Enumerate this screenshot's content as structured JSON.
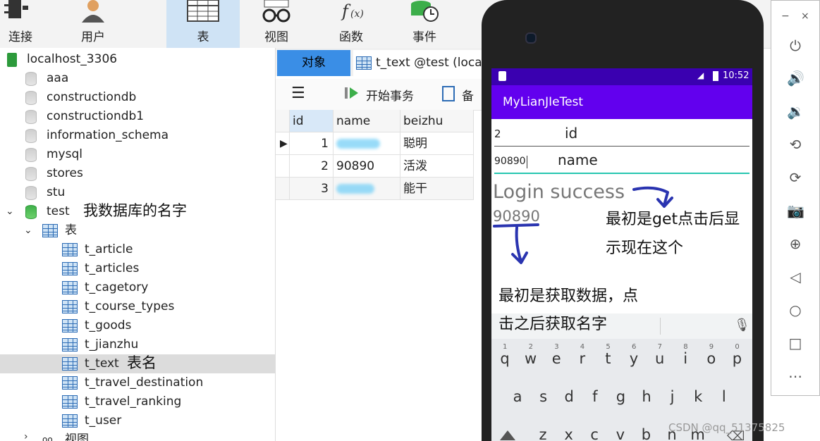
{
  "toolbar": {
    "items": [
      {
        "label": "连接",
        "icon": "plug-icon"
      },
      {
        "label": "用户",
        "icon": "user-icon"
      },
      {
        "label": "表",
        "icon": "table-icon",
        "active": true
      },
      {
        "label": "视图",
        "icon": "glasses-icon"
      },
      {
        "label": "函数",
        "icon": "function-icon"
      },
      {
        "label": "事件",
        "icon": "event-clock-icon"
      }
    ]
  },
  "tree": {
    "connection": "localhost_3306",
    "databases": [
      "aaa",
      "constructiondb",
      "constructiondb1",
      "information_schema",
      "mysql",
      "stores",
      "stu"
    ],
    "open_db": "test",
    "open_db_note": "我数据库的名字",
    "tables_folder": "表",
    "tables": [
      "t_article",
      "t_articles",
      "t_cagetory",
      "t_course_types",
      "t_goods",
      "t_jianzhu",
      "t_text",
      "t_travel_destination",
      "t_travel_ranking",
      "t_user"
    ],
    "selected_table_note": "表名",
    "views_folder": "视图"
  },
  "mid": {
    "tab_objects": "对象",
    "tab_table": "t_text @test (loca",
    "begin_tx": "开始事务",
    "backup": "备",
    "columns": [
      "id",
      "name",
      "beizhu"
    ],
    "rows": [
      {
        "id": "1",
        "name": "",
        "beizhu": "聪明"
      },
      {
        "id": "2",
        "name": "90890",
        "beizhu": "活泼"
      },
      {
        "id": "3",
        "name": "",
        "beizhu": "能干"
      }
    ]
  },
  "phone": {
    "time": "10:52",
    "app_title": "MyLianJIeTest",
    "id_value": "2",
    "id_label": "id",
    "name_value": "90890",
    "name_label": "name",
    "login_text": "Login success",
    "result_text": "90890",
    "note1": "最初是get点击后显示现在这个",
    "note1_a": "最初是get点击后显",
    "note1_b": "示现在这个",
    "note2_a": "最初是获取数据，点",
    "note2_b": "击之后获取名字",
    "keys_row1": [
      "q",
      "w",
      "e",
      "r",
      "t",
      "y",
      "u",
      "i",
      "o",
      "p"
    ],
    "keys_row1_nums": [
      "1",
      "2",
      "3",
      "4",
      "5",
      "6",
      "7",
      "8",
      "9",
      "0"
    ],
    "keys_row2": [
      "a",
      "s",
      "d",
      "f",
      "g",
      "h",
      "j",
      "k",
      "l"
    ],
    "keys_row3": [
      "z",
      "x",
      "c",
      "v",
      "b",
      "n",
      "m"
    ]
  },
  "watermark": "CSDN @qq_51375825",
  "emulator": {
    "min": "−",
    "close": "×",
    "icons": [
      "power-icon",
      "volume-up-icon",
      "volume-down-icon",
      "rotate-left-icon",
      "rotate-right-icon",
      "camera-icon",
      "zoom-icon",
      "back-icon",
      "home-icon",
      "overview-icon",
      "more-icon"
    ]
  }
}
